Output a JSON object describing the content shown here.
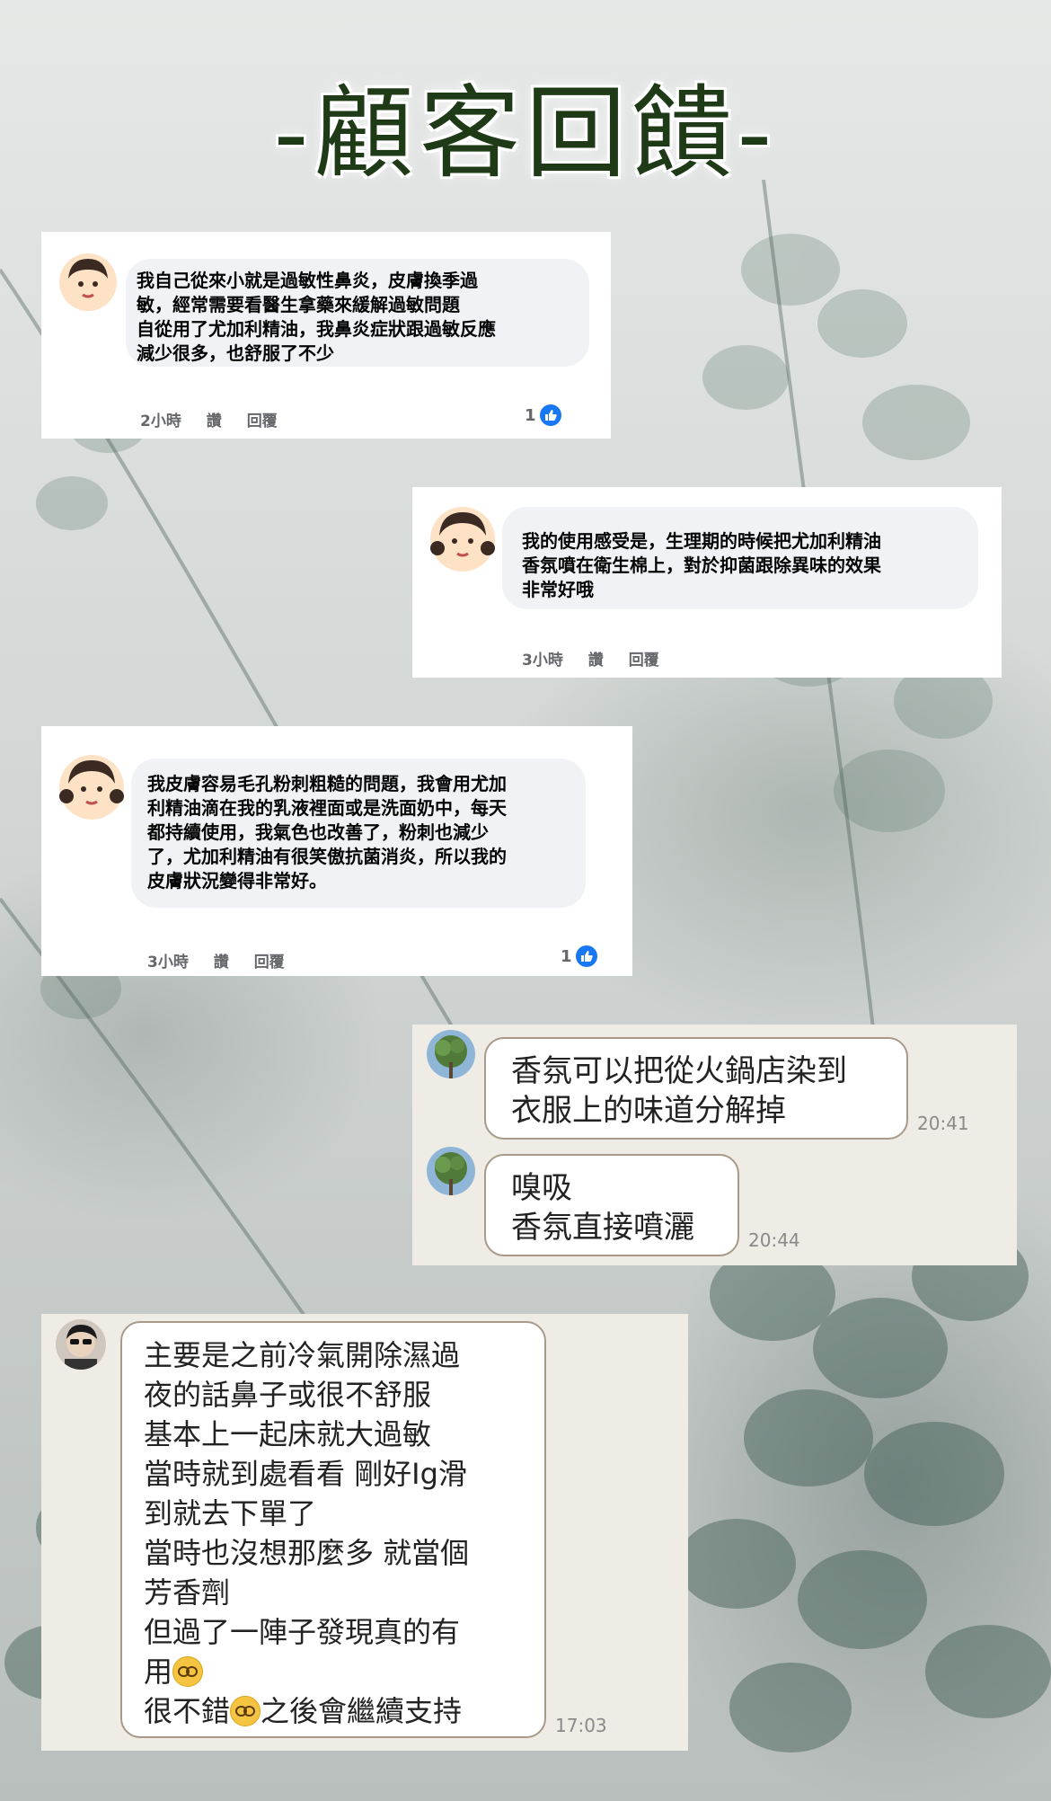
{
  "title": "-顧客回饋-",
  "reviews_fb": [
    {
      "lines": [
        "我自己從來小就是過敏性鼻炎，皮膚換季過",
        "敏，經常需要看醫生拿藥來緩解過敏問題",
        "自從用了尤加利精油，我鼻炎症狀跟過敏反應",
        "減少很多，也舒服了不少"
      ],
      "time": "2小時",
      "read": "讚",
      "reply": "回覆",
      "likes": "1"
    },
    {
      "lines": [
        "我的使用感受是，生理期的時候把尤加利精油",
        "香氛噴在衛生棉上，對於抑菌跟除異味的效果",
        "非常好哦"
      ],
      "time": "3小時",
      "read": "讚",
      "reply": "回覆"
    },
    {
      "lines": [
        "我皮膚容易毛孔粉刺粗糙的問題，我會用尤加",
        "利精油滴在我的乳液裡面或是洗面奶中，每天",
        "都持續使用，我氣色也改善了，粉刺也減少",
        "了，尤加利精油有很笑傲抗菌消炎，所以我的",
        "皮膚狀況變得非常好。"
      ],
      "time": "3小時",
      "read": "讚",
      "reply": "回覆",
      "likes": "1"
    }
  ],
  "line_chat": [
    {
      "lines": [
        "香氛可以把從火鍋店染到",
        "衣服上的味道分解掉"
      ],
      "time": "20:41"
    },
    {
      "lines": [
        "嗅吸",
        "香氛直接噴灑"
      ],
      "time": "20:44"
    }
  ],
  "long_message": {
    "lines": [
      "主要是之前冷氣開除濕過",
      "夜的話鼻子或很不舒服",
      "基本上一起床就大過敏",
      "當時就到處看看 剛好Ig滑",
      "到就去下單了",
      "當時也沒想那麼多 就當個",
      "芳香劑",
      "但過了一陣子發現真的有"
    ],
    "line9": "用",
    "line10a": "很不錯",
    "line10b": "之後會繼續支持",
    "time": "17:03"
  }
}
